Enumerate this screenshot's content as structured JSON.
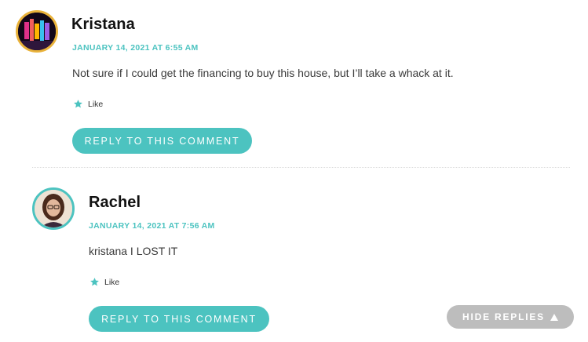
{
  "colors": {
    "accent": "#4cc3c0",
    "author": "#111111",
    "text": "#3a3a3a",
    "hide_button": "#bdbdbd",
    "avatar_ring_1": "#e9b23a",
    "avatar_ring_2": "#4cc3c0"
  },
  "comments": [
    {
      "author": "Kristana",
      "date": "JANUARY 14, 2021 AT 6:55 AM",
      "text": "Not sure if I could get the financing to buy this house, but I’ll take a whack at it.",
      "like_label": "Like",
      "like_icon": "star-icon",
      "reply_label": "REPLY TO THIS COMMENT"
    },
    {
      "author": "Rachel",
      "date": "JANUARY 14, 2021 AT 7:56 AM",
      "text": "kristana I LOST IT",
      "like_label": "Like",
      "like_icon": "star-icon",
      "reply_label": "REPLY TO THIS COMMENT"
    }
  ],
  "hide_replies": {
    "label": "HIDE REPLIES",
    "icon": "triangle-up-icon"
  }
}
